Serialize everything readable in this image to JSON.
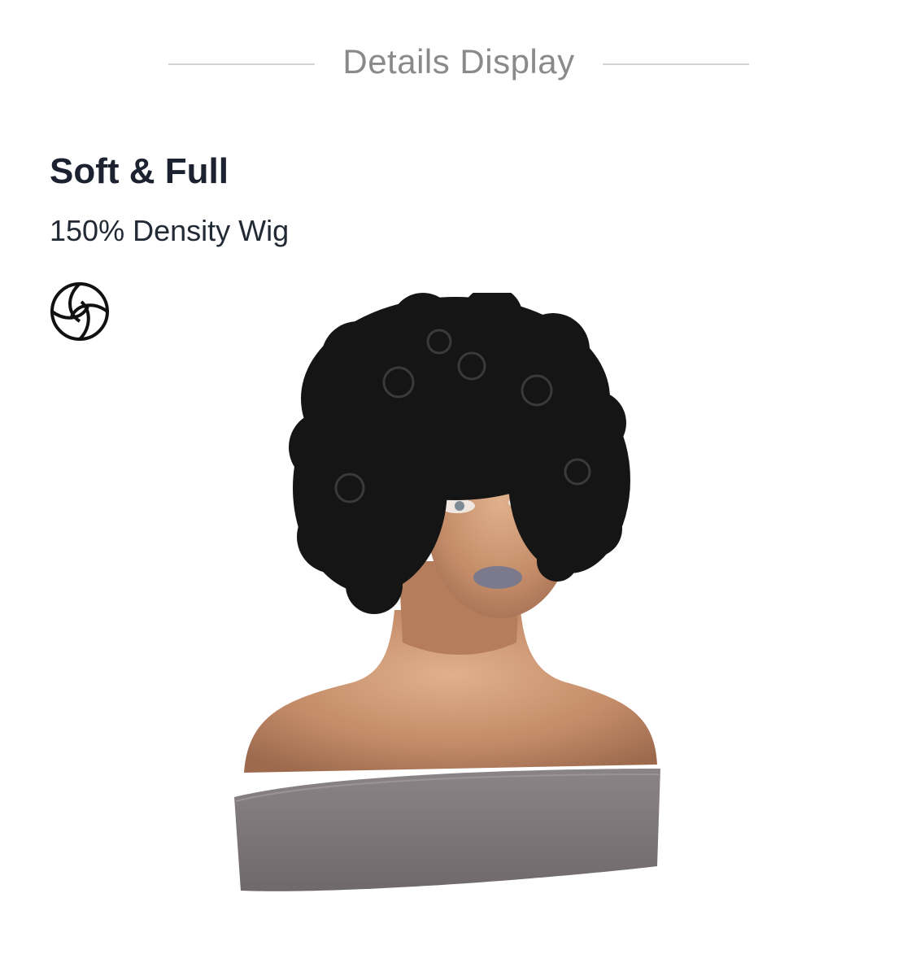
{
  "header": {
    "title": "Details Display"
  },
  "feature": {
    "title": "Soft & Full",
    "subtitle": "150% Density Wig",
    "icon": "soft-sphere-icon"
  },
  "product_image": {
    "subject": "curly black wig on mannequin"
  },
  "colors": {
    "header_text": "#8a8a8a",
    "divider": "#d3d3d3",
    "title_text": "#1c2230",
    "hair": "#151515",
    "skin": "#c89170",
    "fabric": "#7a7477"
  }
}
